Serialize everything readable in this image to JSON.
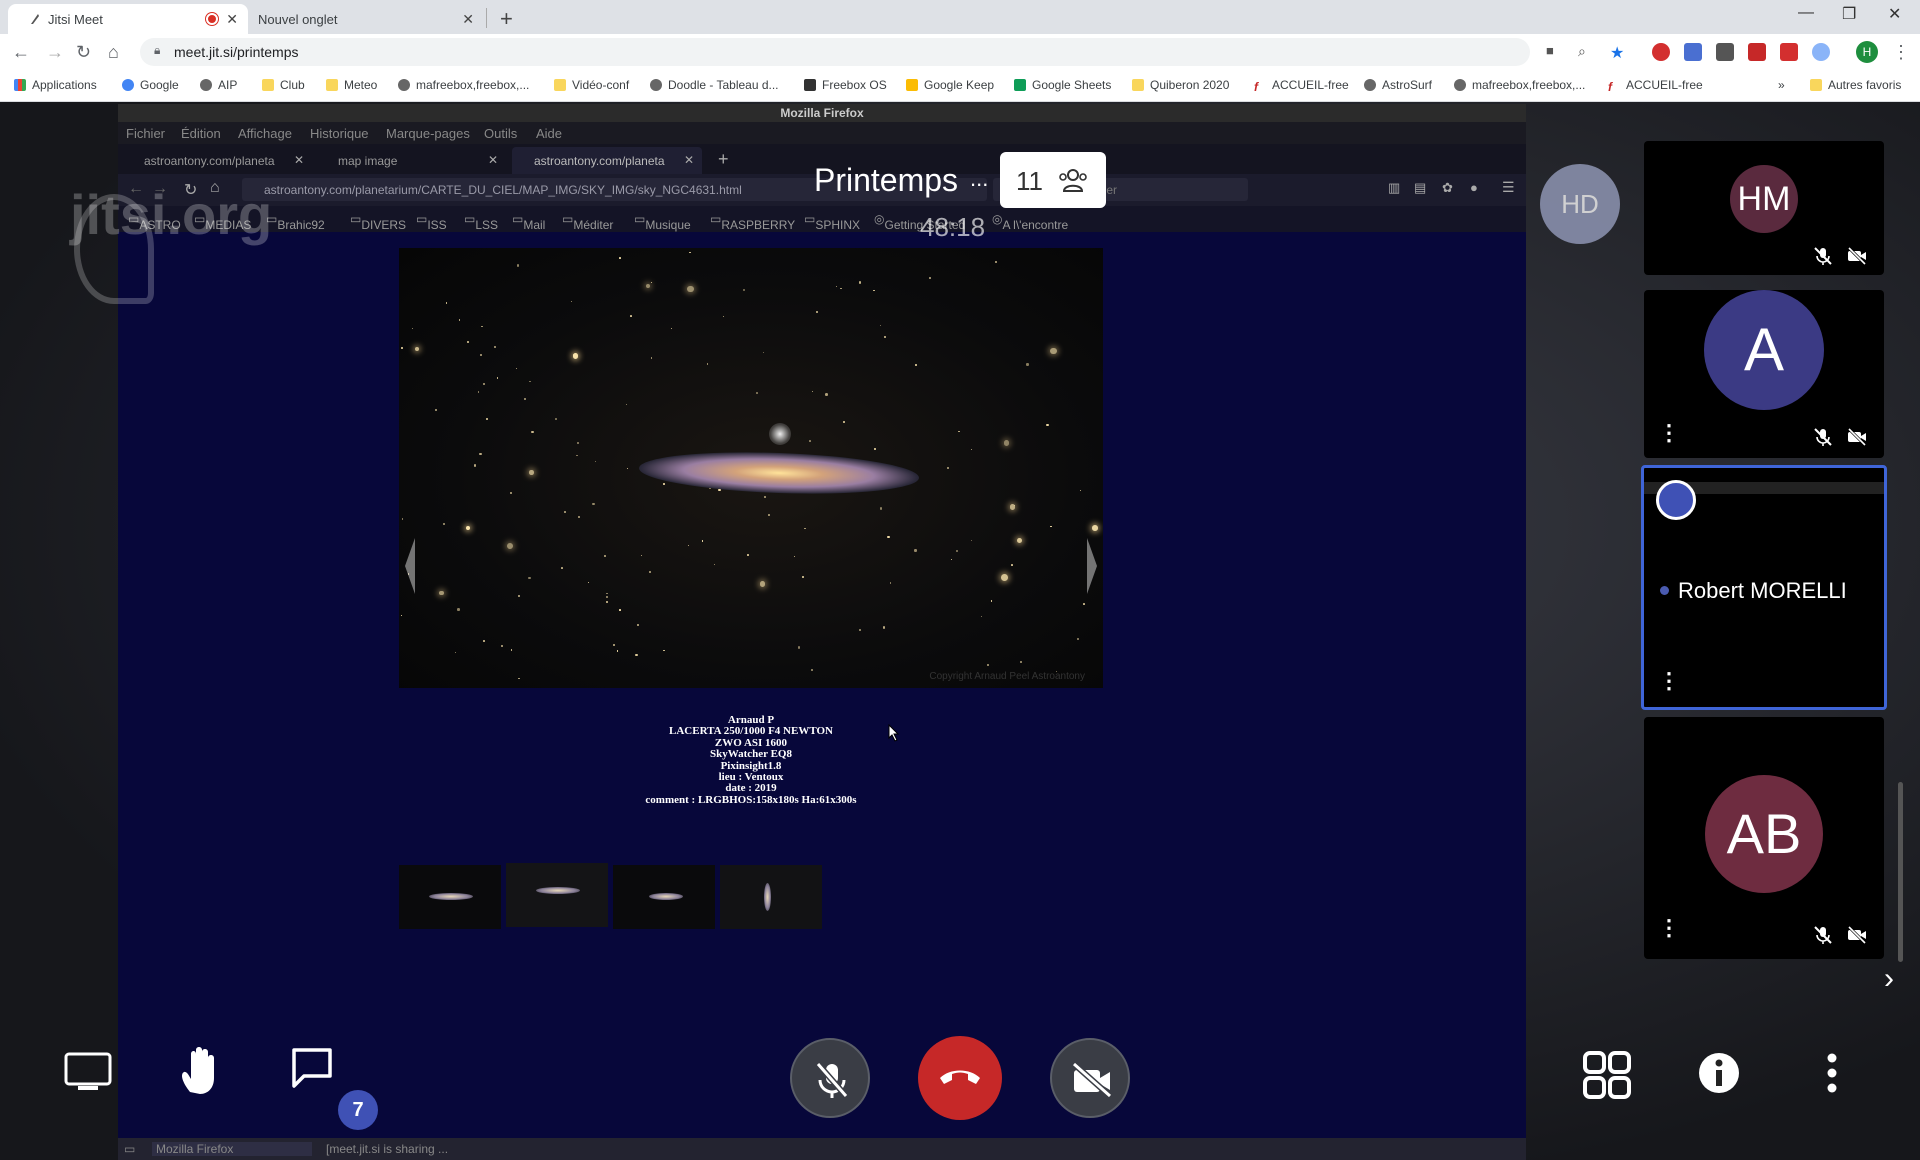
{
  "chrome": {
    "tabs": [
      {
        "label": "Jitsi Meet",
        "active": true
      },
      {
        "label": "Nouvel onglet",
        "active": false
      }
    ],
    "url": "meet.jit.si/printemps",
    "bookmarks": [
      "Applications",
      "Google",
      "AIP",
      "Club",
      "Meteo",
      "mafreebox,freebox,...",
      "Vidéo-conf",
      "Doodle - Tableau d...",
      "Freebox OS",
      "Google Keep",
      "Google Sheets",
      "Quiberon 2020",
      "ACCUEIL-free",
      "AstroSurf",
      "mafreebox,freebox,...",
      "ACCUEIL-free"
    ],
    "bookmarks_more": "»",
    "other_favorites": "Autres favoris",
    "profile_initial": "H"
  },
  "shared": {
    "window_title": "Mozilla Firefox",
    "menu": [
      "Fichier",
      "Édition",
      "Affichage",
      "Historique",
      "Marque-pages",
      "Outils",
      "Aide"
    ],
    "tabs": [
      {
        "label": "astroantony.com/planeta"
      },
      {
        "label": "map image"
      },
      {
        "label": "astroantony.com/planeta"
      }
    ],
    "url": "astroantony.com/planetarium/CARTE_DU_CIEL/MAP_IMG/SKY_IMG/sky_NGC4631.html",
    "search_placeholder": "ercher",
    "bookmarks": [
      "ASTRO",
      "MEDIAS",
      "Brahic92",
      "DIVERS",
      "ISS",
      "LSS",
      "Mail",
      "Méditer",
      "Musique",
      "RASPBERRY",
      "SPHINX",
      "Getting Started",
      "A l\\'encontre"
    ],
    "caption": [
      "Arnaud P",
      "LACERTA 250/1000 F4 NEWTON",
      "ZWO ASI 1600",
      "SkyWatcher EQ8",
      "Pixinsight1.8",
      "lieu : Ventoux",
      "date : 2019",
      "comment : LRGBHOS:158x180s Ha:61x300s"
    ],
    "copyright": "Copyright Arnaud Peel Astroantony",
    "taskbar": [
      "Mozilla Firefox",
      "[meet.jit.si is sharing ..."
    ]
  },
  "jitsi": {
    "watermark": "jitsi.org",
    "subject": "Printemps",
    "subject_more": "...",
    "participant_count": "11",
    "timer": "48:18",
    "local_avatar": "HD",
    "tiles": [
      {
        "initials": "HM",
        "color": "#5a2a3e"
      },
      {
        "initials": "A",
        "color": "#3b3a84"
      },
      {
        "name": "Robert MORELLI"
      },
      {
        "initials": "AB",
        "color": "#6e2c40"
      }
    ],
    "chat_unread": "7",
    "accent": "#3f51b5",
    "hangup_color": "#c62828"
  }
}
